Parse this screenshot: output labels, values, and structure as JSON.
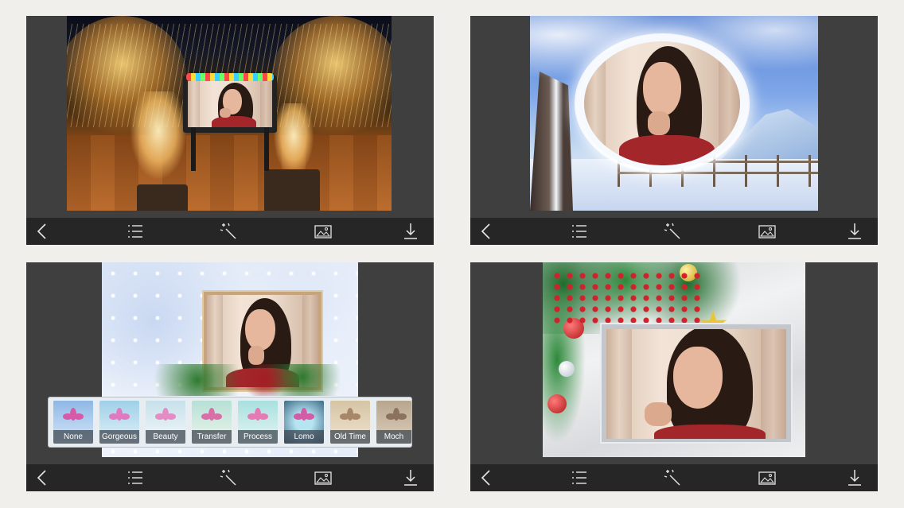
{
  "toolbar": {
    "icons": [
      "back-icon",
      "list-icon",
      "magic-wand-icon",
      "image-icon",
      "download-icon"
    ]
  },
  "panels": [
    {
      "scene": "christmas lights street at night with billboard frame"
    },
    {
      "scene": "snowy winter tree with oval frost frame"
    },
    {
      "scene": "snowflake background with filter selector"
    },
    {
      "scene": "christmas ornaments garland frame"
    }
  ],
  "filters": [
    {
      "label": "None",
      "selected": true
    },
    {
      "label": "Gorgeous"
    },
    {
      "label": "Beauty"
    },
    {
      "label": "Transfer"
    },
    {
      "label": "Process"
    },
    {
      "label": "Lomo"
    },
    {
      "label": "Old Time"
    },
    {
      "label": "Moch"
    }
  ],
  "colors": {
    "panel_bg": "#3f3f3f",
    "toolbar_bg": "#262626",
    "page_bg": "#f0efeb",
    "selected_filter": "#2a7cd6"
  }
}
